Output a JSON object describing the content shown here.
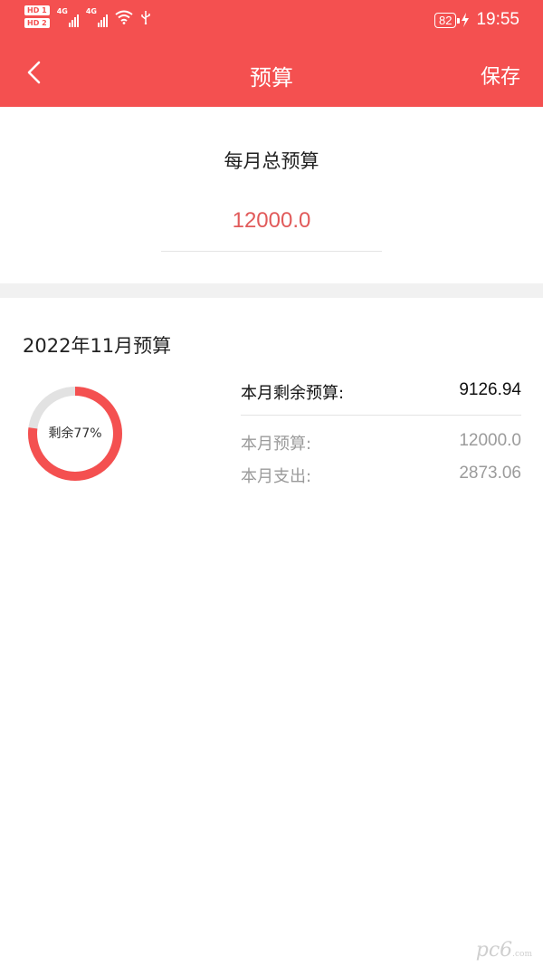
{
  "status_bar": {
    "sim1": "HD 1",
    "sim2": "HD 2",
    "net1": "4G",
    "net2": "4G",
    "battery": "82",
    "time": "19:55"
  },
  "nav": {
    "back_icon": "chevron-left-icon",
    "title": "预算",
    "save_label": "保存"
  },
  "monthly_budget": {
    "label": "每月总预算",
    "value": "12000.0"
  },
  "month_summary": {
    "title": "2022年11月预算",
    "donut_label": "剩余77%",
    "remaining_fraction": 0.77,
    "remaining_label": "本月剩余预算:",
    "remaining_value": "9126.94",
    "budget_label": "本月预算:",
    "budget_value": "12000.0",
    "expense_label": "本月支出:",
    "expense_value": "2873.06"
  },
  "colors": {
    "accent": "#f45050",
    "value_red": "#e15a5a",
    "ring_track": "#e2e2e2",
    "muted_text": "#9b9b9b"
  },
  "watermark": {
    "text": "pc6",
    "sub": ".com"
  }
}
